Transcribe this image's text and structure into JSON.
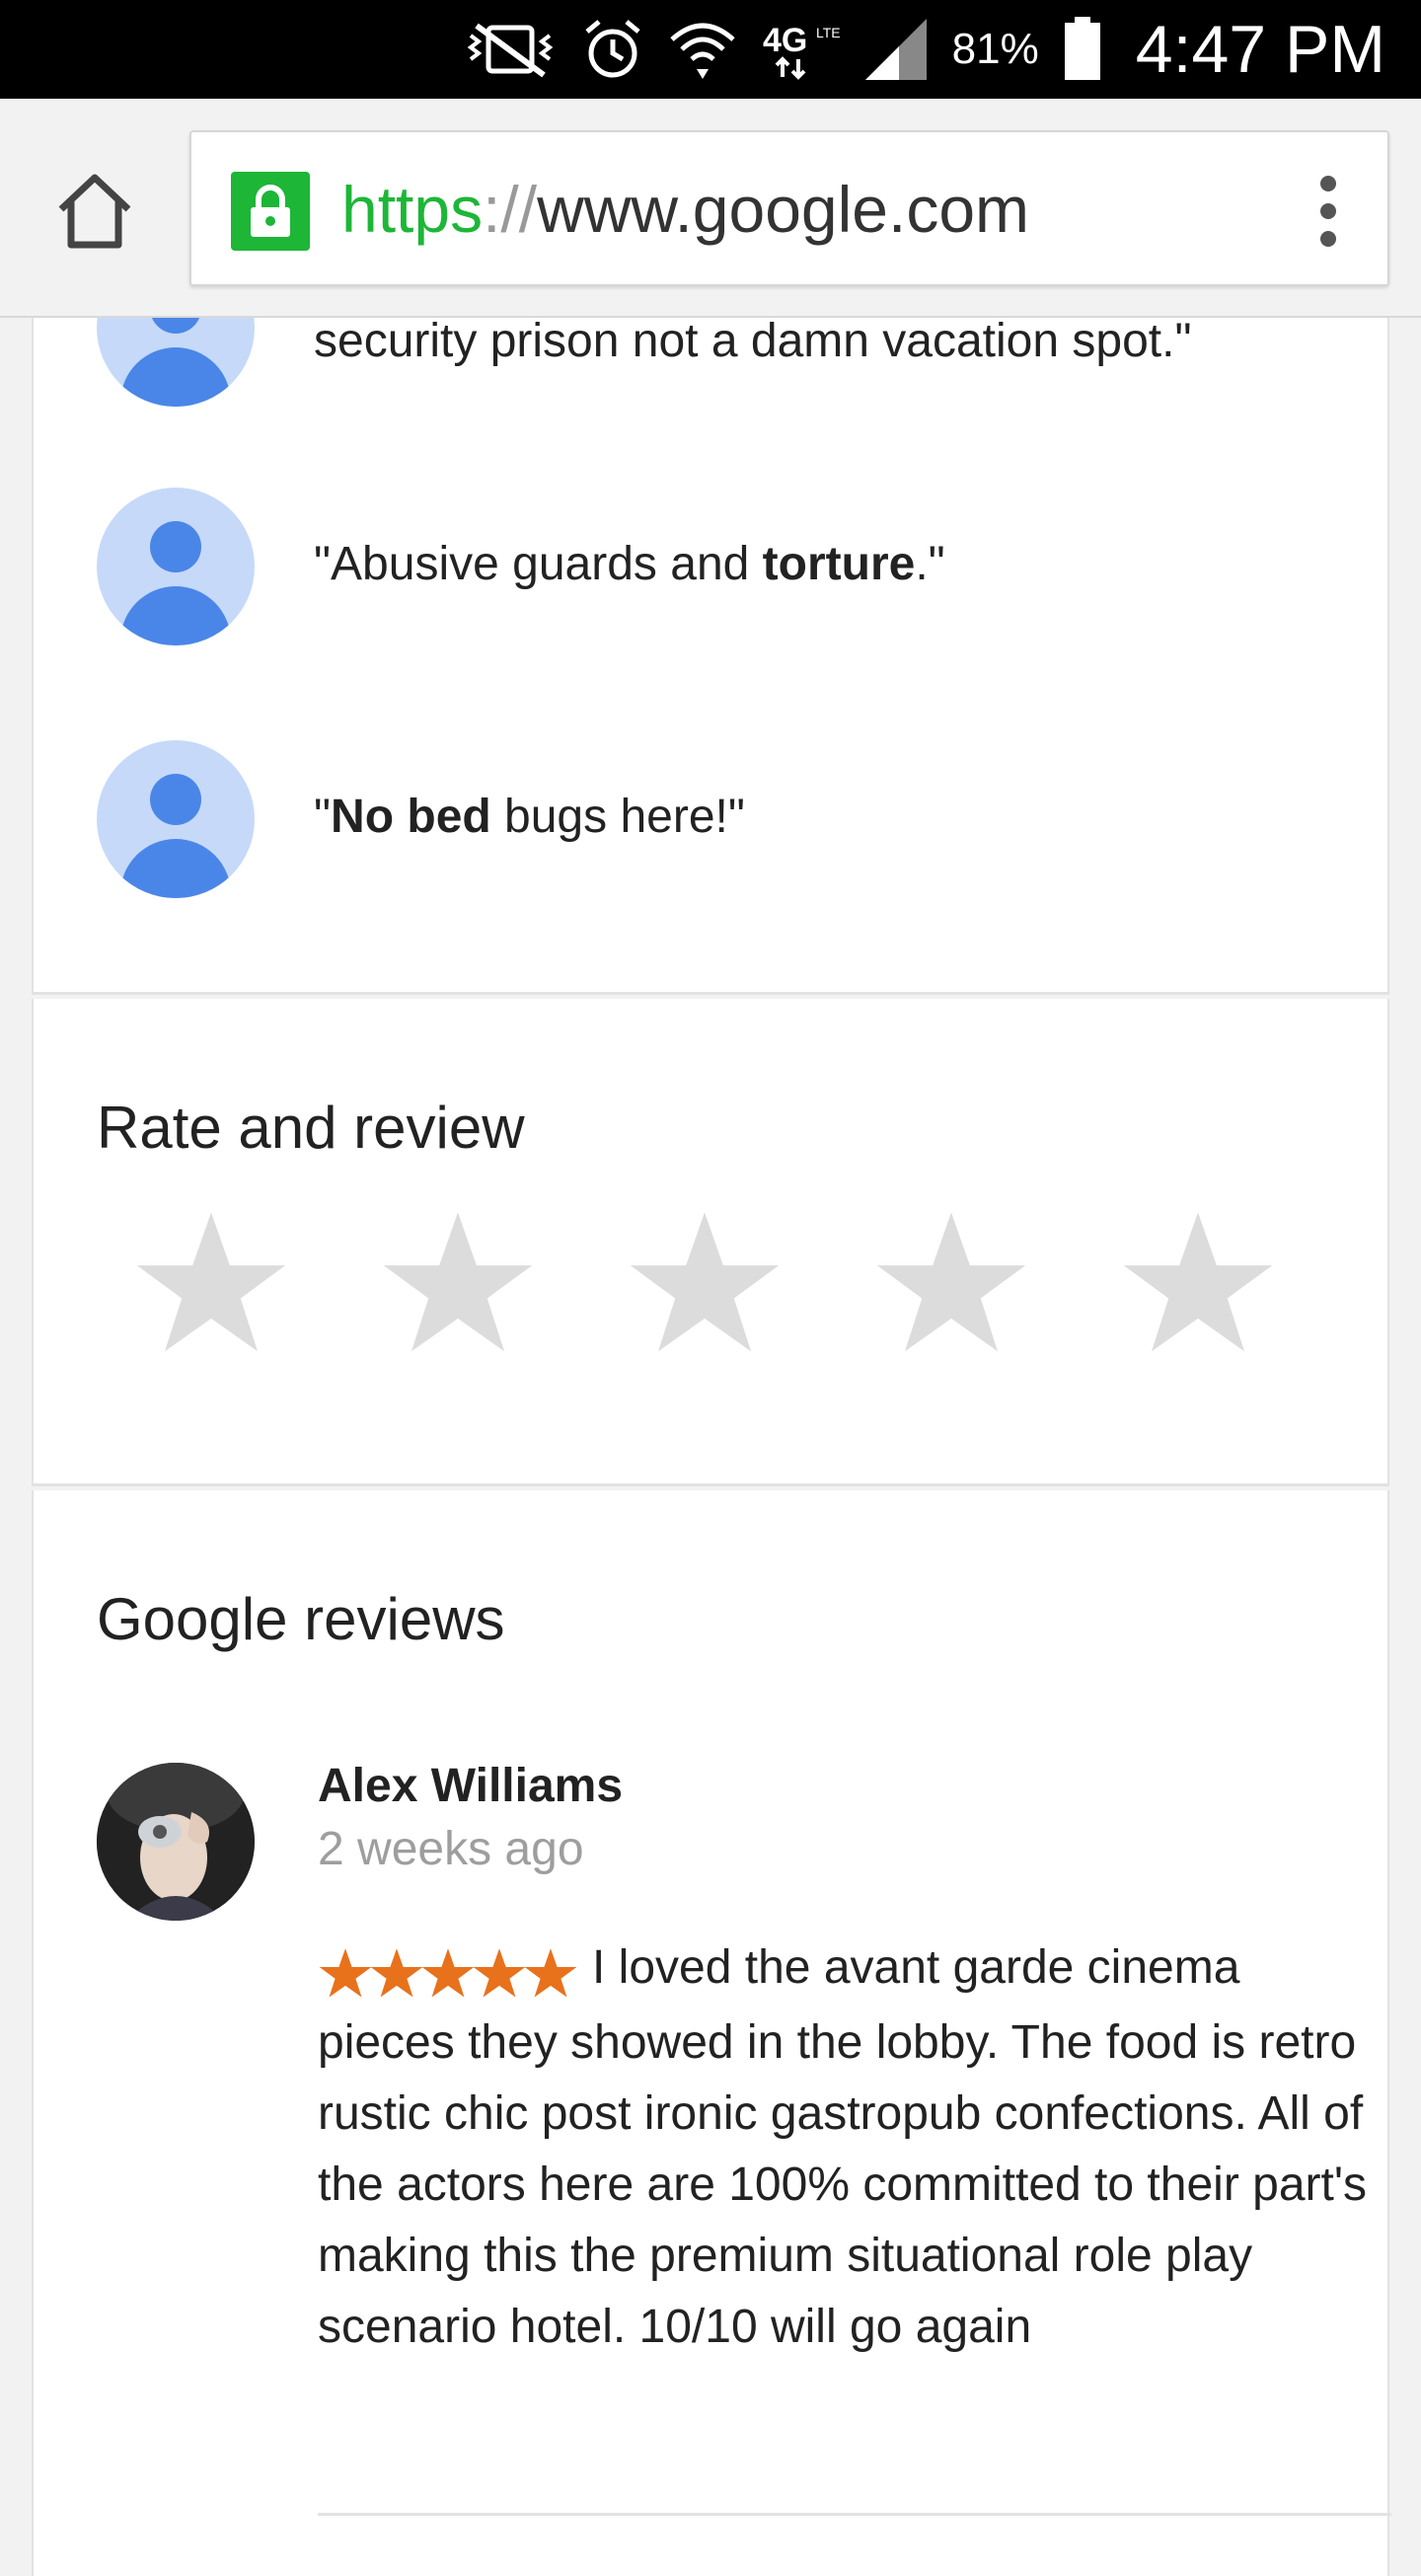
{
  "status_bar": {
    "battery": "81%",
    "time": "4:47 PM",
    "network": "4G",
    "network_sub": "LTE"
  },
  "browser": {
    "url_scheme": "https",
    "url_separator": "://",
    "url_host": "www.google.com"
  },
  "snippets": [
    {
      "parts": [
        {
          "text": "security prison not a damn vacation spot.\"",
          "bold": false
        }
      ]
    },
    {
      "parts": [
        {
          "text": "\"Abusive guards and ",
          "bold": false
        },
        {
          "text": "torture",
          "bold": true
        },
        {
          "text": ".\"",
          "bold": false
        }
      ]
    },
    {
      "parts": [
        {
          "text": "\"",
          "bold": false
        },
        {
          "text": "No bed",
          "bold": true
        },
        {
          "text": " bugs here!\"",
          "bold": false
        }
      ]
    }
  ],
  "rate_section": {
    "title": "Rate and review",
    "star_count": 5,
    "selected": 0
  },
  "reviews_section": {
    "title": "Google reviews",
    "reviews": [
      {
        "author": "Alex Williams",
        "time": "2 weeks ago",
        "rating": 5,
        "text": "I loved the avant garde cinema pieces they showed in the lobby. The food is retro rustic chic post ironic gastropub confections. All of the actors here are 100% committed to their part's making this the premium situational role play scenario hotel. 10/10 will go again"
      }
    ]
  },
  "colors": {
    "secure_green": "#1db637",
    "avatar_blue": "#4a86e8",
    "avatar_bg": "#c6d9f9",
    "star_empty": "#dcdcdc",
    "star_filled": "#e8711c"
  },
  "icons": {
    "home": "home-icon",
    "lock": "lock-icon",
    "menu": "overflow-menu-icon",
    "star": "star-icon"
  }
}
